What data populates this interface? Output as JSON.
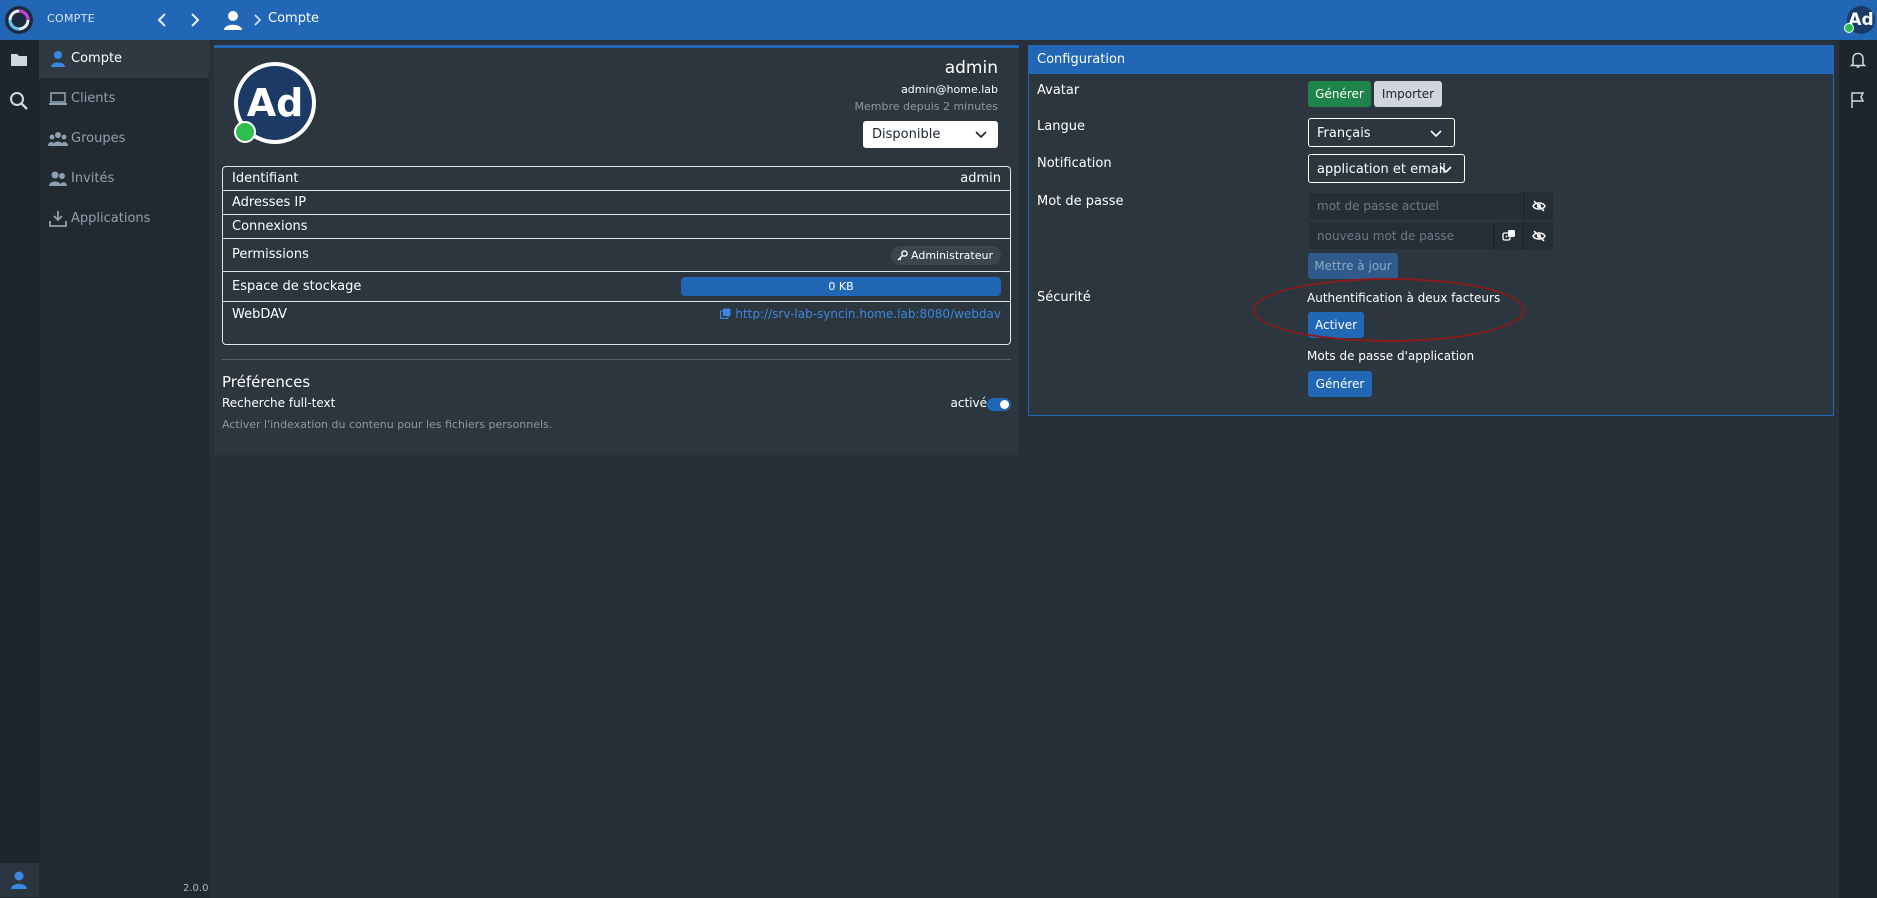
{
  "topbar": {
    "section": "COMPTE",
    "breadcrumb": "Compte",
    "avatar_initials": "Ad"
  },
  "sidebar": {
    "items": [
      {
        "label": "Compte",
        "icon": "user-icon",
        "active": true
      },
      {
        "label": "Clients",
        "icon": "laptop-icon",
        "active": false
      },
      {
        "label": "Groupes",
        "icon": "users-icon",
        "active": false
      },
      {
        "label": "Invités",
        "icon": "user-group-icon",
        "active": false
      },
      {
        "label": "Applications",
        "icon": "download-icon",
        "active": false
      }
    ],
    "version": "2.0.0"
  },
  "profile": {
    "avatar_initials": "Ad",
    "name": "admin",
    "email": "admin@home.lab",
    "member_since": "Membre depuis 2 minutes",
    "status": "Disponible"
  },
  "info": {
    "identifiant_label": "Identifiant",
    "identifiant_value": "admin",
    "ip_label": "Adresses IP",
    "connexions_label": "Connexions",
    "permissions_label": "Permissions",
    "permissions_value": "Administrateur",
    "storage_label": "Espace de stockage",
    "storage_value": "0 KB",
    "storage_fraction": 1.0,
    "webdav_label": "WebDAV",
    "webdav_url": "http://srv-lab-syncin.home.lab:8080/webdav"
  },
  "preferences": {
    "title": "Préférences",
    "fulltext_label": "Recherche full-text",
    "fulltext_state": "activé",
    "fulltext_enabled": true,
    "fulltext_hint": "Activer l'indexation du contenu pour les fichiers personnels."
  },
  "config": {
    "title": "Configuration",
    "avatar_label": "Avatar",
    "avatar_generate": "Générer",
    "avatar_import": "Importer",
    "langue_label": "Langue",
    "langue_value": "Français",
    "notification_label": "Notification",
    "notification_value": "application et email",
    "password_label": "Mot de passe",
    "current_password_placeholder": "mot de passe actuel",
    "new_password_placeholder": "nouveau mot de passe",
    "update_button": "Mettre à jour",
    "security_label": "Sécurité",
    "twofa_title": "Authentification à deux facteurs",
    "twofa_button": "Activer",
    "app_passwords_title": "Mots de passe d'application",
    "app_passwords_button": "Générer"
  },
  "colors": {
    "accent": "#2167b6",
    "success": "#2dbf4e",
    "green_button": "#1e8449",
    "annotation": "#8b1a1a"
  }
}
